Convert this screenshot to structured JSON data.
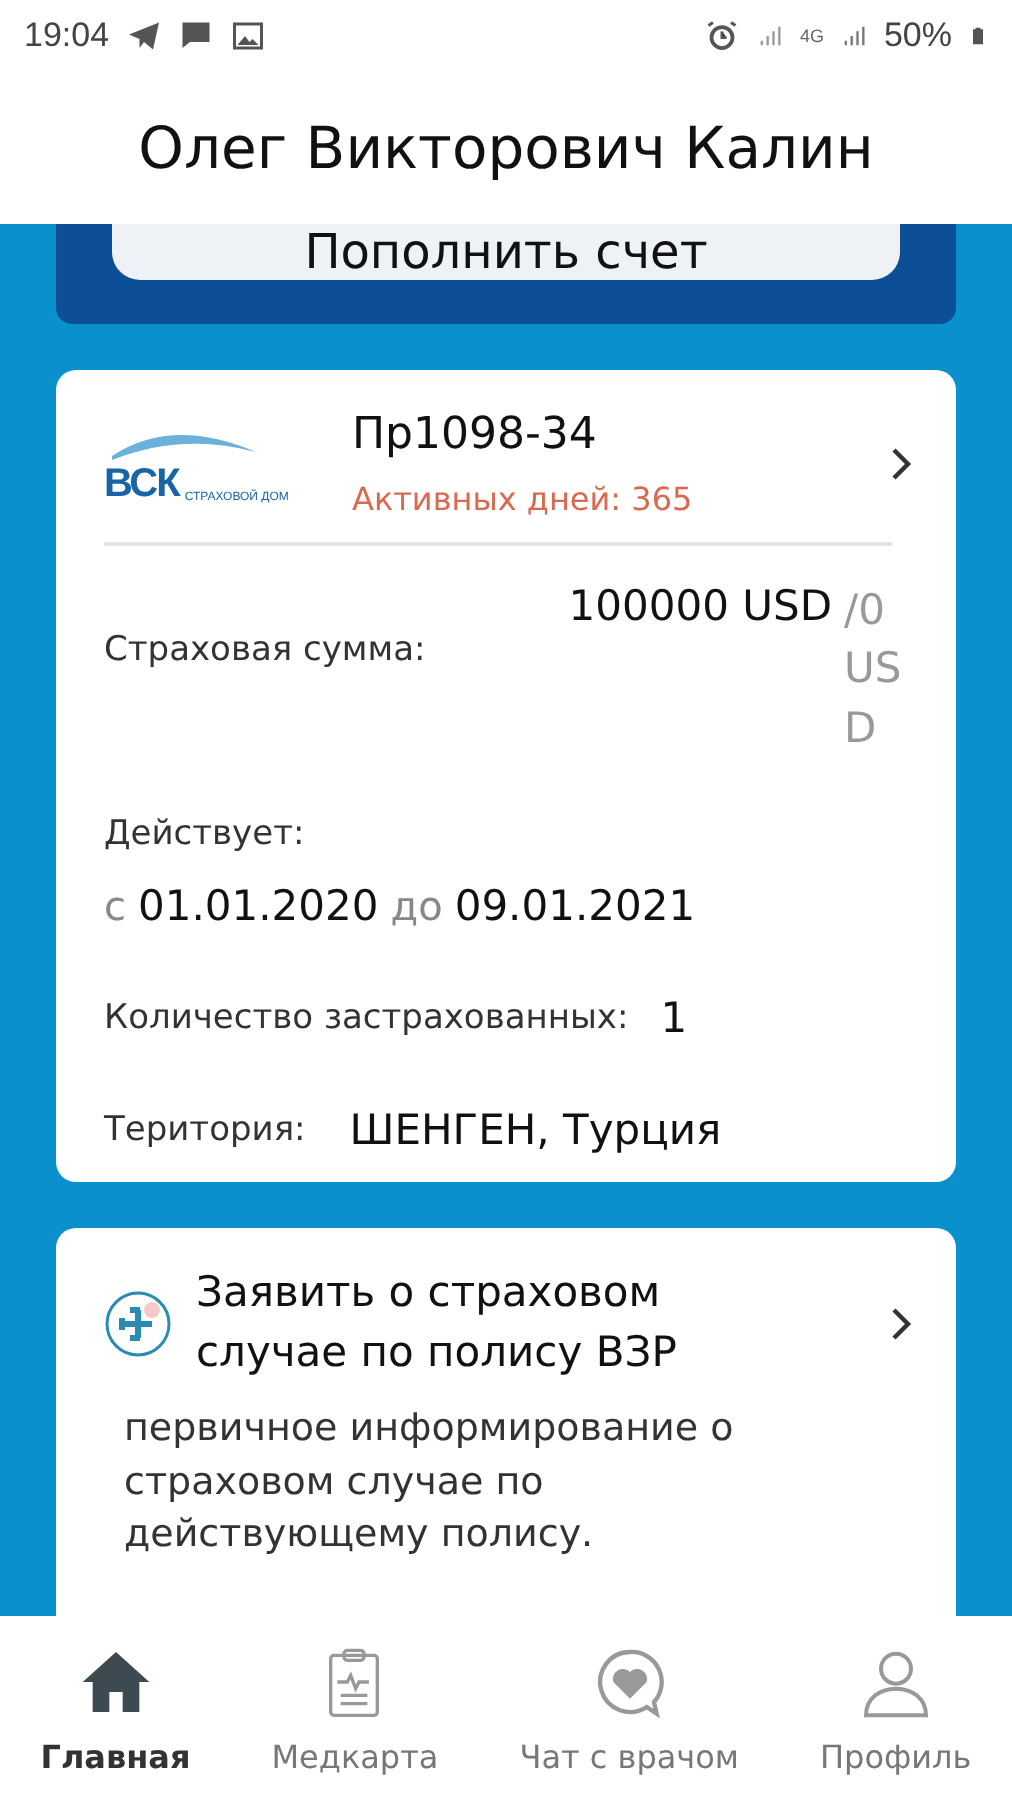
{
  "status_bar": {
    "time": "19:04",
    "network": "4G",
    "battery": "50%"
  },
  "header": {
    "title": "Олег Викторович Калин"
  },
  "top_panel": {
    "button": "Пополнить счет"
  },
  "policy_card": {
    "logo_mark": "ВСК",
    "logo_caption": "СТРАХОВОЙ ДОМ",
    "number": "Пр1098-34",
    "active_days": "Активных дней: 365",
    "sum_label": "Страховая сумма:",
    "sum_value": "100000 USD",
    "sum_used": "/0 USD",
    "valid_label": "Действует:",
    "from_label": "с",
    "from_date": "01.01.2020",
    "to_label": "до",
    "to_date": "09.01.2021",
    "insured_label": "Количество застрахованных:",
    "insured_value": "1",
    "territory_label": "Територия:",
    "territory_value": "ШЕНГЕН, Турция"
  },
  "claim_card": {
    "title": "Заявить о страховом случае по полису ВЗР",
    "description": "первичное информирование о страховом случае по действующему полису."
  },
  "bottom_nav": [
    {
      "label": "Главная",
      "kind": "home",
      "selected": true
    },
    {
      "label": "Медкарта",
      "kind": "clipboard",
      "selected": false
    },
    {
      "label": "Чат с врачом",
      "kind": "chat",
      "selected": false
    },
    {
      "label": "Профиль",
      "kind": "user",
      "selected": false
    }
  ]
}
